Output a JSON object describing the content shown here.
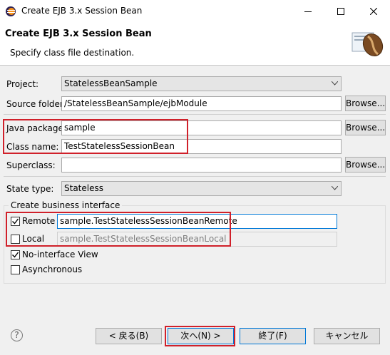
{
  "window": {
    "title": "Create EJB 3.x Session Bean",
    "minimize_icon": "minimize-icon",
    "maximize_icon": "maximize-icon",
    "close_icon": "close-icon"
  },
  "header": {
    "title": "Create EJB 3.x Session Bean",
    "subtitle": "Specify class file destination.",
    "icon": "coffee-bean-icon"
  },
  "form": {
    "project_label": "Project:",
    "project_value": "StatelessBeanSample",
    "source_label": "Source folder:",
    "source_value": "/StatelessBeanSample/ejbModule",
    "browse_label": "Browse...",
    "package_label": "Java package:",
    "package_value": "sample",
    "class_label": "Class name:",
    "class_value": "TestStatelessSessionBean",
    "superclass_label": "Superclass:",
    "superclass_value": "",
    "statetype_label": "State type:",
    "statetype_value": "Stateless"
  },
  "business": {
    "group_title": "Create business interface",
    "remote_label": "Remote",
    "remote_checked": true,
    "remote_value": "sample.TestStatelessSessionBeanRemote",
    "local_label": "Local",
    "local_checked": false,
    "local_value": "sample.TestStatelessSessionBeanLocal",
    "nointerface_label": "No-interface View",
    "nointerface_checked": true,
    "async_label": "Asynchronous",
    "async_checked": false
  },
  "footer": {
    "help_glyph": "?",
    "back_label": "< 戻る(B)",
    "next_label": "次へ(N) >",
    "finish_label": "終了(F)",
    "cancel_label": "キャンセル"
  },
  "colors": {
    "highlight": "#d0202a",
    "focus_border": "#0078d7"
  }
}
